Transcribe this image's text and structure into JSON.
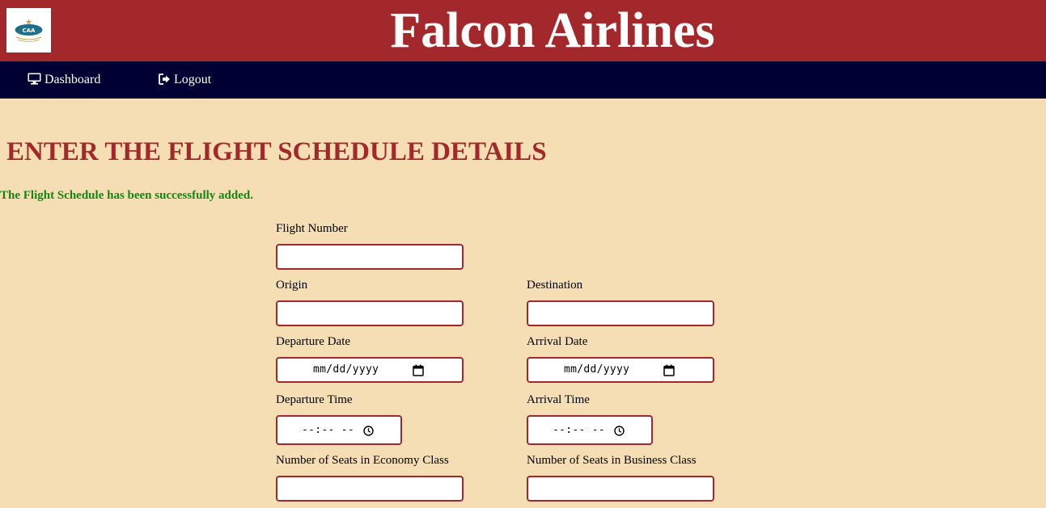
{
  "header": {
    "brand": "Falcon Airlines",
    "logo_text": "CAA"
  },
  "nav": {
    "items": [
      {
        "label": "Dashboard",
        "icon": "monitor-icon"
      },
      {
        "label": "Logout",
        "icon": "sign-out-icon"
      }
    ]
  },
  "page": {
    "title": "ENTER THE FLIGHT SCHEDULE DETAILS",
    "success_message": "The Flight Schedule has been successfully added."
  },
  "form": {
    "flight_number": {
      "label": "Flight Number",
      "value": ""
    },
    "origin": {
      "label": "Origin",
      "value": ""
    },
    "destination": {
      "label": "Destination",
      "value": ""
    },
    "departure_date": {
      "label": "Departure Date",
      "placeholder": "mm/dd/yyyy"
    },
    "arrival_date": {
      "label": "Arrival Date",
      "placeholder": "mm/dd/yyyy"
    },
    "departure_time": {
      "label": "Departure Time",
      "placeholder": "--:-- --"
    },
    "arrival_time": {
      "label": "Arrival Time",
      "placeholder": "--:-- --"
    },
    "economy_seats": {
      "label": "Number of Seats in Economy Class",
      "value": ""
    },
    "business_seats": {
      "label": "Number of Seats in Business Class",
      "value": ""
    }
  },
  "colors": {
    "header_bg": "#a3282b",
    "nav_bg": "#000033",
    "page_bg": "#f5deb3",
    "success": "#118811"
  }
}
